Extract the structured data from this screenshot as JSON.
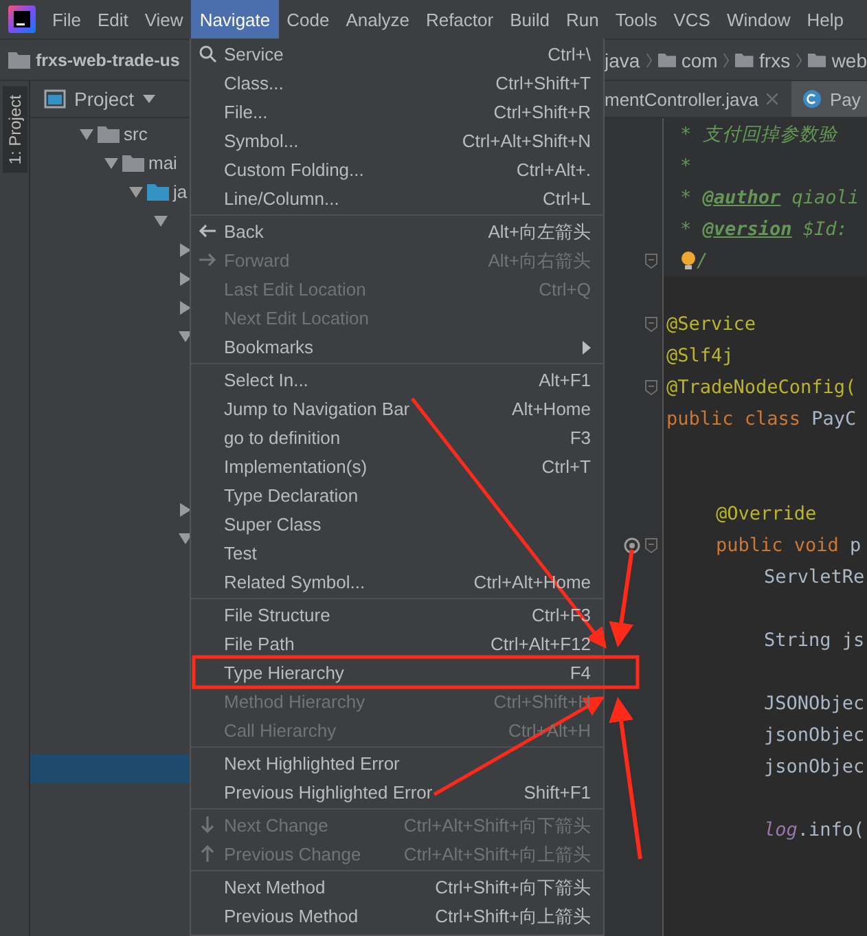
{
  "menubar": [
    {
      "label": "File",
      "selected": false
    },
    {
      "label": "Edit",
      "selected": false
    },
    {
      "label": "View",
      "selected": false
    },
    {
      "label": "Navigate",
      "selected": true
    },
    {
      "label": "Code",
      "selected": false
    },
    {
      "label": "Analyze",
      "selected": false
    },
    {
      "label": "Refactor",
      "selected": false
    },
    {
      "label": "Build",
      "selected": false
    },
    {
      "label": "Run",
      "selected": false
    },
    {
      "label": "Tools",
      "selected": false
    },
    {
      "label": "VCS",
      "selected": false
    },
    {
      "label": "Window",
      "selected": false
    },
    {
      "label": "Help",
      "selected": false
    }
  ],
  "breadcrumb": {
    "project": "frxs-web-trade-us",
    "path": [
      "java",
      "com",
      "frxs",
      "web"
    ]
  },
  "side_strip": {
    "label": "1: Project"
  },
  "project_panel": {
    "title": "Project",
    "tree": [
      {
        "label": "src",
        "expanded": true,
        "selected": false,
        "children": [
          {
            "label": "mai",
            "expanded": true,
            "selected": false,
            "children": [
              {
                "label": "ja",
                "expanded": true,
                "selected": false,
                "children": [
                  {
                    "expanded": true,
                    "selected": false,
                    "children": [
                      {
                        "expanded": false,
                        "selected": false
                      },
                      {
                        "expanded": false,
                        "selected": false
                      },
                      {
                        "expanded": false,
                        "selected": false
                      },
                      {
                        "expanded": true,
                        "selected": false,
                        "children": [
                          {
                            "selected": false
                          },
                          {
                            "selected": false
                          },
                          {
                            "selected": false
                          },
                          {
                            "selected": false
                          },
                          {
                            "selected": false
                          }
                        ]
                      },
                      {
                        "expanded": false,
                        "selected": false
                      },
                      {
                        "expanded": true,
                        "selected": false,
                        "children": [
                          {
                            "selected": false
                          },
                          {
                            "selected": false
                          },
                          {
                            "selected": false
                          },
                          {
                            "selected": false
                          },
                          {
                            "selected": false
                          },
                          {
                            "selected": false
                          },
                          {
                            "selected": false
                          },
                          {
                            "selected": true
                          }
                        ]
                      }
                    ]
                  }
                ]
              }
            ]
          }
        ]
      }
    ]
  },
  "editor_tabs": [
    {
      "label": "mentController.java",
      "selected": false,
      "closable": true
    },
    {
      "label": "Pay",
      "selected": true,
      "closable": false
    }
  ],
  "code": [
    {
      "kind": "doc",
      "fold": false,
      "override": false,
      "tokens": [
        {
          "kind": "comment",
          "text": "* 支付回掉参数验"
        }
      ]
    },
    {
      "kind": "doc",
      "fold": false,
      "override": false,
      "tokens": [
        {
          "kind": "comment",
          "text": "*"
        }
      ]
    },
    {
      "kind": "doc",
      "fold": false,
      "override": false,
      "tokens": [
        {
          "kind": "comment",
          "text": "* "
        },
        {
          "kind": "doctag",
          "text": "@author"
        },
        {
          "kind": "comment",
          "text": " qiaoli"
        }
      ]
    },
    {
      "kind": "doc",
      "fold": false,
      "override": false,
      "tokens": [
        {
          "kind": "comment",
          "text": "* "
        },
        {
          "kind": "doctag",
          "text": "@version"
        },
        {
          "kind": "comment",
          "text": " $Id:"
        }
      ]
    },
    {
      "kind": "doc_end",
      "fold": true,
      "override": false,
      "tokens": [
        {
          "kind": "comment",
          "text": "/"
        }
      ]
    },
    {
      "kind": "blank",
      "fold": false,
      "override": false
    },
    {
      "kind": "top",
      "fold": true,
      "override": false,
      "tokens": [
        {
          "kind": "annotation",
          "text": "@Service"
        }
      ]
    },
    {
      "kind": "top",
      "fold": false,
      "override": false,
      "tokens": [
        {
          "kind": "annotation",
          "text": "@Slf4j"
        }
      ]
    },
    {
      "kind": "top",
      "fold": true,
      "override": false,
      "tokens": [
        {
          "kind": "annotation",
          "text": "@TradeNodeConfig("
        }
      ]
    },
    {
      "kind": "top",
      "fold": false,
      "override": false,
      "tokens": [
        {
          "kind": "keyword",
          "text": "public class "
        },
        {
          "kind": "plain",
          "text": "PayC"
        }
      ]
    },
    {
      "kind": "blank",
      "fold": false,
      "override": false
    },
    {
      "kind": "blank",
      "fold": false,
      "override": false
    },
    {
      "kind": "member",
      "fold": false,
      "override": false,
      "tokens": [
        {
          "kind": "annotation",
          "text": "@Override"
        }
      ]
    },
    {
      "kind": "member",
      "fold": true,
      "override": true,
      "tokens": [
        {
          "kind": "keyword",
          "text": "public void "
        },
        {
          "kind": "plain",
          "text": "p"
        }
      ]
    },
    {
      "kind": "body",
      "fold": false,
      "override": false,
      "tokens": [
        {
          "kind": "plain",
          "text": "ServletRe"
        }
      ]
    },
    {
      "kind": "blank",
      "fold": false,
      "override": false
    },
    {
      "kind": "body",
      "fold": false,
      "override": false,
      "tokens": [
        {
          "kind": "plain",
          "text": "String js"
        }
      ]
    },
    {
      "kind": "blank",
      "fold": false,
      "override": false
    },
    {
      "kind": "body",
      "fold": false,
      "override": false,
      "tokens": [
        {
          "kind": "plain",
          "text": "JSONObjec"
        }
      ]
    },
    {
      "kind": "body",
      "fold": false,
      "override": false,
      "tokens": [
        {
          "kind": "plain",
          "text": "jsonObjec"
        }
      ]
    },
    {
      "kind": "body",
      "fold": false,
      "override": false,
      "tokens": [
        {
          "kind": "plain",
          "text": "jsonObjec"
        }
      ]
    },
    {
      "kind": "blank",
      "fold": false,
      "override": false
    },
    {
      "kind": "body",
      "fold": false,
      "override": false,
      "tokens": [
        {
          "kind": "field",
          "text": "log"
        },
        {
          "kind": "plain",
          "text": ".info("
        }
      ]
    }
  ],
  "navigate_menu": [
    {
      "kind": "search",
      "label": "Service",
      "shortcut": "Ctrl+\\",
      "disabled": false
    },
    {
      "kind": "item",
      "label": "Class...",
      "shortcut": "Ctrl+Shift+T",
      "disabled": false
    },
    {
      "kind": "item",
      "label": "File...",
      "shortcut": "Ctrl+Shift+R",
      "disabled": false
    },
    {
      "kind": "item",
      "label": "Symbol...",
      "shortcut": "Ctrl+Alt+Shift+N",
      "disabled": false
    },
    {
      "kind": "item",
      "label": "Custom Folding...",
      "shortcut": "Ctrl+Alt+.",
      "disabled": false
    },
    {
      "kind": "item",
      "label": "Line/Column...",
      "shortcut": "Ctrl+L",
      "disabled": false
    },
    {
      "kind": "separator"
    },
    {
      "kind": "back",
      "label": "Back",
      "shortcut": "Alt+向左箭头",
      "disabled": false
    },
    {
      "kind": "forward",
      "label": "Forward",
      "shortcut": "Alt+向右箭头",
      "disabled": true
    },
    {
      "kind": "item",
      "label": "Last Edit Location",
      "shortcut": "Ctrl+Q",
      "disabled": true
    },
    {
      "kind": "item",
      "label": "Next Edit Location",
      "disabled": true
    },
    {
      "kind": "submenu",
      "label": "Bookmarks",
      "disabled": false
    },
    {
      "kind": "separator"
    },
    {
      "kind": "item",
      "label": "Select In...",
      "shortcut": "Alt+F1",
      "disabled": false
    },
    {
      "kind": "item",
      "label": "Jump to Navigation Bar",
      "shortcut": "Alt+Home",
      "disabled": false
    },
    {
      "kind": "item",
      "label": "go to definition",
      "shortcut": "F3",
      "disabled": false
    },
    {
      "kind": "item",
      "label": "Implementation(s)",
      "shortcut": "Ctrl+T",
      "disabled": false
    },
    {
      "kind": "item",
      "label": "Type Declaration",
      "disabled": false
    },
    {
      "kind": "item",
      "label": "Super Class",
      "disabled": false
    },
    {
      "kind": "item",
      "label": "Test",
      "disabled": false
    },
    {
      "kind": "item",
      "label": "Related Symbol...",
      "shortcut": "Ctrl+Alt+Home",
      "disabled": false
    },
    {
      "kind": "separator"
    },
    {
      "kind": "item",
      "label": "File Structure",
      "shortcut": "Ctrl+F3",
      "disabled": false
    },
    {
      "kind": "item",
      "label": "File Path",
      "shortcut": "Ctrl+Alt+F12",
      "disabled": false
    },
    {
      "kind": "item",
      "label": "Type Hierarchy",
      "shortcut": "F4",
      "disabled": false
    },
    {
      "kind": "item",
      "label": "Method Hierarchy",
      "shortcut": "Ctrl+Shift+H",
      "disabled": true
    },
    {
      "kind": "item",
      "label": "Call Hierarchy",
      "shortcut": "Ctrl+Alt+H",
      "disabled": true
    },
    {
      "kind": "separator"
    },
    {
      "kind": "item",
      "label": "Next Highlighted Error",
      "disabled": false
    },
    {
      "kind": "item",
      "label": "Previous Highlighted Error",
      "shortcut": "Shift+F1",
      "disabled": false
    },
    {
      "kind": "separator"
    },
    {
      "kind": "down",
      "label": "Next Change",
      "shortcut": "Ctrl+Alt+Shift+向下箭头",
      "disabled": true
    },
    {
      "kind": "up",
      "label": "Previous Change",
      "shortcut": "Ctrl+Alt+Shift+向上箭头",
      "disabled": true
    },
    {
      "kind": "separator"
    },
    {
      "kind": "item",
      "label": "Next Method",
      "shortcut": "Ctrl+Shift+向下箭头",
      "disabled": false
    },
    {
      "kind": "item",
      "label": "Previous Method",
      "shortcut": "Ctrl+Shift+向上箭头",
      "disabled": false
    }
  ]
}
